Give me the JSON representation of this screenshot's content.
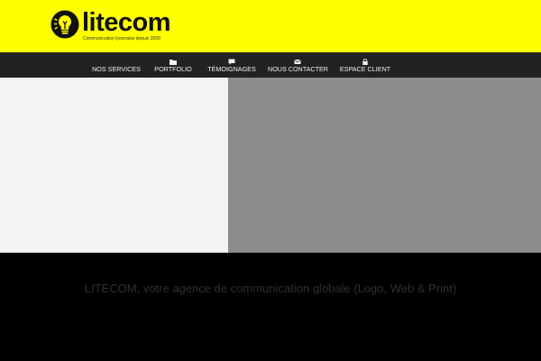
{
  "brand": {
    "name": "litecom",
    "tagline": "Communication lyonnaise depuis 2009",
    "colors": {
      "header_bg": "#ffff00",
      "nav_bg": "#222222",
      "logo_dark": "#111111"
    }
  },
  "nav": {
    "items": [
      {
        "label": "NOS SERVICES",
        "icon": ""
      },
      {
        "label": "PORTFOLIO",
        "icon": "folder-icon"
      },
      {
        "label": "TÉMOIGNAGES",
        "icon": "speech-bubble-icon"
      },
      {
        "label": "NOUS CONTACTER",
        "icon": "envelope-icon"
      },
      {
        "label": "ESPACE CLIENT",
        "icon": "lock-icon"
      }
    ]
  },
  "main": {
    "headline": "LITECOM, votre agence de communication globale (Logo, Web & Print)",
    "panel_colors": {
      "left": "#f2f3f5",
      "right": "#8c8c8c"
    }
  }
}
